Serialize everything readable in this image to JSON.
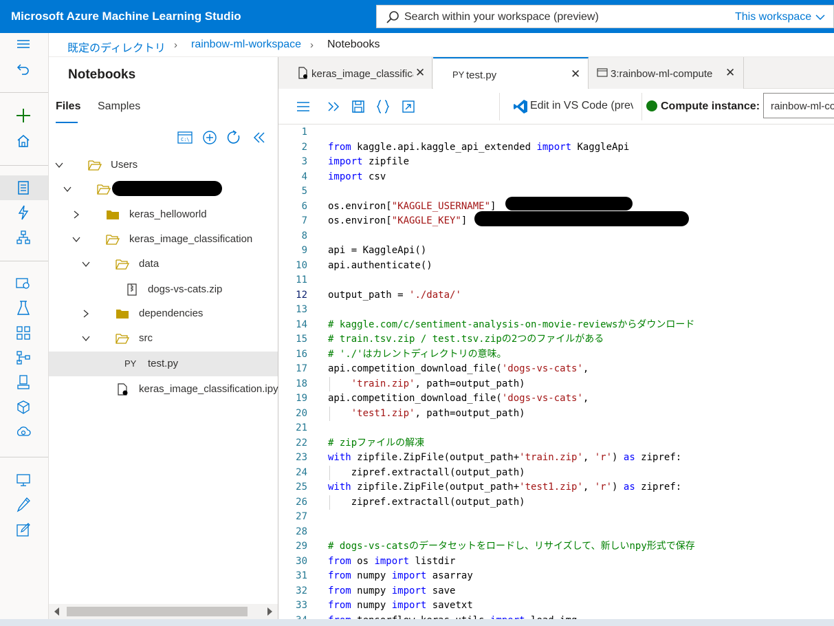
{
  "app": {
    "title": "Microsoft Azure Machine Learning Studio",
    "search_placeholder": "Search within your workspace (preview)",
    "search_scope": "This workspace"
  },
  "breadcrumb": [
    "既定のディレクトリ",
    "rainbow-ml-workspace",
    "Notebooks"
  ],
  "panel": {
    "title": "Notebooks",
    "tabs": [
      "Files",
      "Samples"
    ],
    "active_tab": "Files",
    "tree": [
      {
        "label": "Users",
        "type": "folder-open",
        "expanded": true
      },
      {
        "label": "",
        "type": "folder-open",
        "expanded": true,
        "redacted": true
      },
      {
        "label": "keras_helloworld",
        "type": "folder",
        "expanded": false
      },
      {
        "label": "keras_image_classification",
        "type": "folder-open",
        "expanded": true
      },
      {
        "label": "data",
        "type": "folder-open",
        "expanded": true
      },
      {
        "label": "dogs-vs-cats.zip",
        "type": "zip-file"
      },
      {
        "label": "dependencies",
        "type": "folder",
        "expanded": false
      },
      {
        "label": "src",
        "type": "folder-open",
        "expanded": true
      },
      {
        "label": "test.py",
        "type": "py-file",
        "selected": true,
        "glyph": "PY"
      },
      {
        "label": "keras_image_classification.ipynb",
        "type": "notebook-file"
      }
    ]
  },
  "editor": {
    "tabs": [
      {
        "label": "keras_image_classification.ipynb",
        "active": false
      },
      {
        "label": "test.py",
        "active": true,
        "glyph": "PY"
      },
      {
        "label": "3:rainbow-ml-compute",
        "active": false
      }
    ],
    "toolbar": {
      "vscode_label": "Edit in VS Code (preview)",
      "compute_label": "Compute instance:",
      "compute_value": "rainbow-ml-compute",
      "compute_status_color": "#107c10"
    },
    "current_line": 12,
    "code": [
      [],
      [
        [
          "kw",
          "from"
        ],
        [
          "t",
          " kaggle.api.kaggle_api_extended "
        ],
        [
          "kw",
          "import"
        ],
        [
          "t",
          " KaggleApi"
        ]
      ],
      [
        [
          "kw",
          "import"
        ],
        [
          "t",
          " zipfile"
        ]
      ],
      [
        [
          "kw",
          "import"
        ],
        [
          "t",
          " csv"
        ]
      ],
      [],
      [
        [
          "t",
          "os.environ["
        ],
        [
          "str",
          "\"KAGGLE_USERNAME\""
        ],
        [
          "t",
          "] "
        ]
      ],
      [
        [
          "t",
          "os.environ["
        ],
        [
          "str",
          "\"KAGGLE_KEY\""
        ],
        [
          "t",
          "] "
        ]
      ],
      [],
      [
        [
          "t",
          "api = KaggleApi()"
        ]
      ],
      [
        [
          "t",
          "api.authenticate()"
        ]
      ],
      [],
      [
        [
          "t",
          "output_path = "
        ],
        [
          "str",
          "'./data/'"
        ]
      ],
      [],
      [
        [
          "cm",
          "# kaggle.com/c/sentiment-analysis-on-movie-reviewsからダウンロード"
        ]
      ],
      [
        [
          "cm",
          "# train.tsv.zip / test.tsv.zipの2つのファイルがある"
        ]
      ],
      [
        [
          "cm",
          "# './'はカレントディレクトリの意味。"
        ]
      ],
      [
        [
          "t",
          "api.competition_download_file("
        ],
        [
          "str",
          "'dogs-vs-cats'"
        ],
        [
          "t",
          ","
        ]
      ],
      [
        [
          "t",
          "    "
        ],
        [
          "str",
          "'train.zip'"
        ],
        [
          "t",
          ", path=output_path)"
        ]
      ],
      [
        [
          "t",
          "api.competition_download_file("
        ],
        [
          "str",
          "'dogs-vs-cats'"
        ],
        [
          "t",
          ","
        ]
      ],
      [
        [
          "t",
          "    "
        ],
        [
          "str",
          "'test1.zip'"
        ],
        [
          "t",
          ", path=output_path)"
        ]
      ],
      [],
      [
        [
          "cm",
          "# zipファイルの解凍"
        ]
      ],
      [
        [
          "kw",
          "with"
        ],
        [
          "t",
          " zipfile.ZipFile(output_path+"
        ],
        [
          "str",
          "'train.zip'"
        ],
        [
          "t",
          ", "
        ],
        [
          "str",
          "'r'"
        ],
        [
          "t",
          ") "
        ],
        [
          "kw",
          "as"
        ],
        [
          "t",
          " zipref:"
        ]
      ],
      [
        [
          "t",
          "    zipref.extractall(output_path)"
        ]
      ],
      [
        [
          "kw",
          "with"
        ],
        [
          "t",
          " zipfile.ZipFile(output_path+"
        ],
        [
          "str",
          "'test1.zip'"
        ],
        [
          "t",
          ", "
        ],
        [
          "str",
          "'r'"
        ],
        [
          "t",
          ") "
        ],
        [
          "kw",
          "as"
        ],
        [
          "t",
          " zipref:"
        ]
      ],
      [
        [
          "t",
          "    zipref.extractall(output_path)"
        ]
      ],
      [],
      [],
      [
        [
          "cm",
          "# dogs-vs-catsのデータセットをロードし、リサイズして、新しいnpy形式で保存"
        ]
      ],
      [
        [
          "kw",
          "from"
        ],
        [
          "t",
          " os "
        ],
        [
          "kw",
          "import"
        ],
        [
          "t",
          " listdir"
        ]
      ],
      [
        [
          "kw",
          "from"
        ],
        [
          "t",
          " numpy "
        ],
        [
          "kw",
          "import"
        ],
        [
          "t",
          " asarray"
        ]
      ],
      [
        [
          "kw",
          "from"
        ],
        [
          "t",
          " numpy "
        ],
        [
          "kw",
          "import"
        ],
        [
          "t",
          " save"
        ]
      ],
      [
        [
          "kw",
          "from"
        ],
        [
          "t",
          " numpy "
        ],
        [
          "kw",
          "import"
        ],
        [
          "t",
          " savetxt"
        ]
      ],
      [
        [
          "kw",
          "from"
        ],
        [
          "t",
          " tensorflow.keras.utils "
        ],
        [
          "kw",
          "import"
        ],
        [
          "t",
          " load_img"
        ]
      ]
    ]
  }
}
